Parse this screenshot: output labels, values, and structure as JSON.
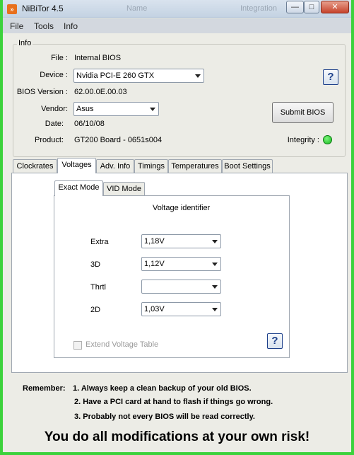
{
  "window": {
    "title": "NiBiTor 4.5",
    "ghost_titles": [
      "Name",
      "Integration"
    ],
    "buttons": {
      "minimize": "—",
      "maximize": "□",
      "close": "✕"
    }
  },
  "menu": [
    "File",
    "Tools",
    "Info"
  ],
  "info": {
    "group_label": "Info",
    "file_label": "File :",
    "file_value": "Internal BIOS",
    "device_label": "Device :",
    "device_value": "Nvidia PCI-E 260 GTX",
    "bios_version_label": "BIOS Version :",
    "bios_version_value": "62.00.0E.00.03",
    "vendor_label": "Vendor:",
    "vendor_value": "Asus",
    "date_label": "Date:",
    "date_value": "06/10/08",
    "product_label": "Product:",
    "product_value": "GT200 Board - 0651s004",
    "integrity_label": "Integrity :",
    "submit_button": "Submit BIOS",
    "help": "?"
  },
  "tabs": [
    "Clockrates",
    "Voltages",
    "Adv. Info",
    "Timings",
    "Temperatures",
    "Boot Settings"
  ],
  "active_tab": "Voltages",
  "subtabs": [
    "Exact Mode",
    "VID Mode"
  ],
  "voltages": {
    "heading": "Voltage identifier",
    "rows": [
      {
        "label": "Extra",
        "value": "1,18V"
      },
      {
        "label": "3D",
        "value": "1,12V"
      },
      {
        "label": "Thrtl",
        "value": ""
      },
      {
        "label": "2D",
        "value": "1,03V"
      }
    ],
    "extend_label": "Extend Voltage Table",
    "help": "?"
  },
  "footer": {
    "remember_label": "Remember:",
    "notes": [
      "1. Always keep a clean backup of your old BIOS.",
      "2. Have a PCI card at hand to flash if things go wrong.",
      "3. Probably not every BIOS will be read correctly."
    ],
    "warning": "You do all modifications at your own risk!"
  }
}
